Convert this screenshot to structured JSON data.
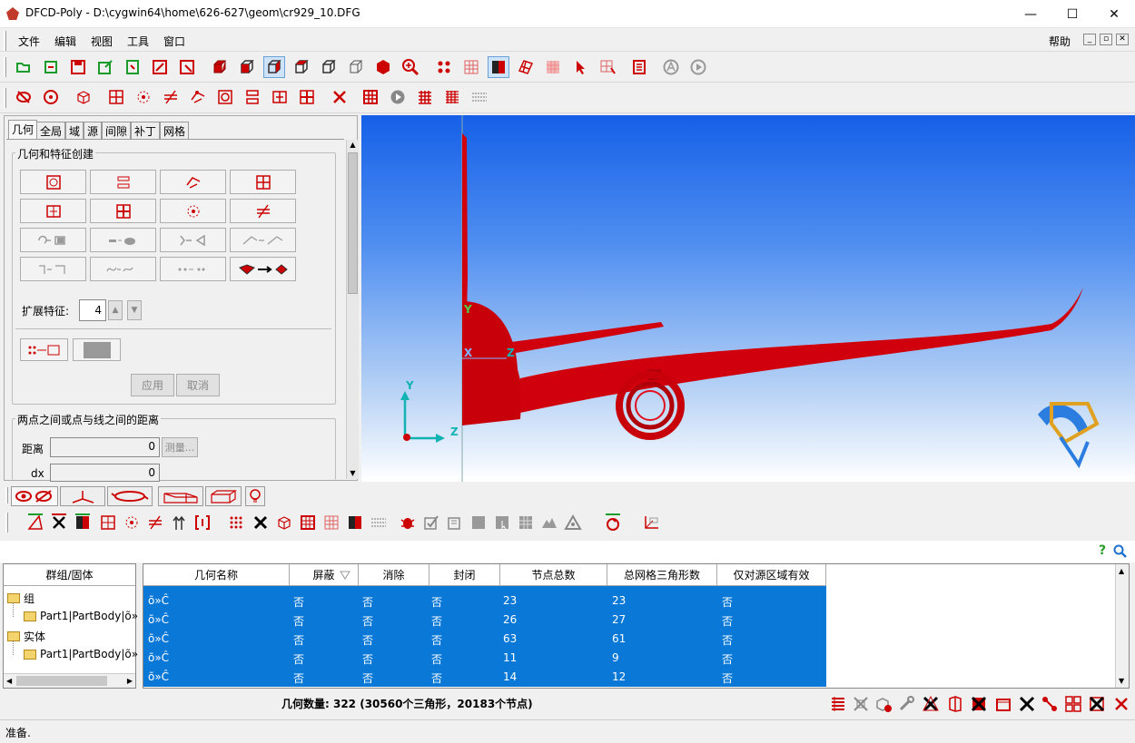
{
  "window": {
    "title": "DFCD-Poly - D:\\cygwin64\\home\\626-627\\geom\\cr929_10.DFG",
    "min_glyph": "—",
    "max_glyph": "☐",
    "close_glyph": "✕"
  },
  "menu": {
    "items": [
      "文件",
      "编辑",
      "视图",
      "工具",
      "窗口"
    ],
    "help": "帮助"
  },
  "left_panel": {
    "tabs": [
      "几何",
      "全局",
      "域",
      "源",
      "间隙",
      "补丁",
      "网格"
    ],
    "group1_title": "几何和特征创建",
    "extend_label": "扩展特征:",
    "extend_value": "4",
    "apply_label": "应用",
    "cancel_label": "取消",
    "group2_title": "两点之间或点与线之间的距离",
    "distance_label": "距离",
    "distance_value": "0",
    "measure_label": "测量...",
    "dx_label": "dx",
    "dx_value": "0"
  },
  "viewport": {
    "axis_y": "Y",
    "axis_x": "X",
    "axis_z": "Z",
    "triad_y": "Y",
    "triad_z": "Z"
  },
  "tree": {
    "header": "群组/固体",
    "items": [
      {
        "label": "组",
        "level": 0
      },
      {
        "label": "Part1|PartBody|õ»",
        "level": 1
      },
      {
        "label": "实体",
        "level": 0
      },
      {
        "label": "Part1|PartBody|õ»",
        "level": 1
      }
    ]
  },
  "grid": {
    "columns": [
      "几何名称",
      "屏蔽",
      "消除",
      "封闭",
      "节点总数",
      "总网格三角形数",
      "仅对源区域有效"
    ],
    "rows": [
      [
        "õ»Ĉ",
        "否",
        "否",
        "否",
        "23",
        "23",
        "否"
      ],
      [
        "õ»Ĉ",
        "否",
        "否",
        "否",
        "26",
        "27",
        "否"
      ],
      [
        "õ»Ĉ",
        "否",
        "否",
        "否",
        "63",
        "61",
        "否"
      ],
      [
        "õ»Ĉ",
        "否",
        "否",
        "否",
        "11",
        "9",
        "否"
      ],
      [
        "õ»Ĉ",
        "否",
        "否",
        "否",
        "14",
        "12",
        "否"
      ]
    ]
  },
  "summary": "几何数量: 322 (30560个三角形，20183个节点)",
  "status": "准备.",
  "colors": {
    "accent": "#cc0000",
    "selection": "#0a78d7",
    "model": "#d0000c"
  }
}
